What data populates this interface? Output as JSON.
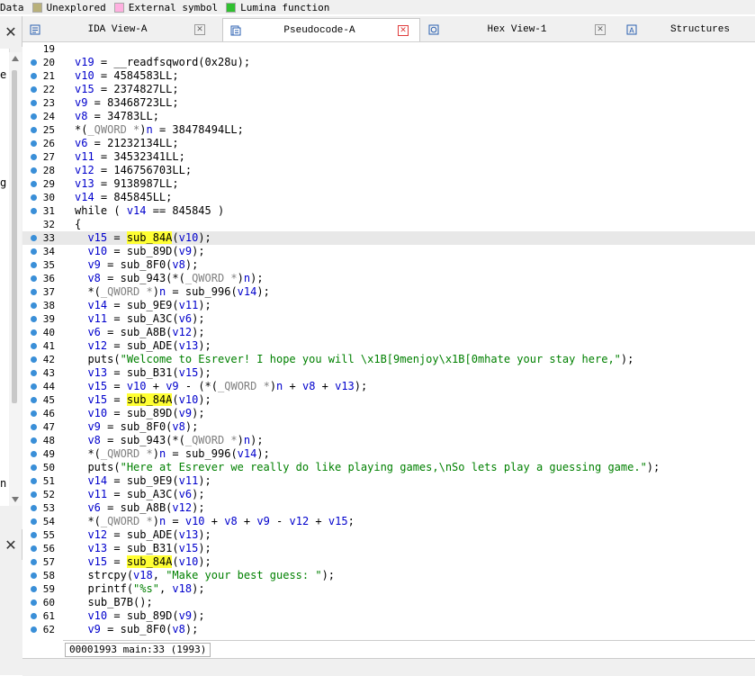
{
  "legend": [
    {
      "label": "Data",
      "color": null
    },
    {
      "label": "Unexplored",
      "color": "#b8b07a"
    },
    {
      "label": "External symbol",
      "color": "#ffb0e0"
    },
    {
      "label": "Lumina function",
      "color": "#30c030"
    }
  ],
  "left_pane": {
    "close_glyph": "✕",
    "cut_chars": [
      "e",
      "g",
      "n"
    ],
    "lower_close_glyph": "✕"
  },
  "tabs": [
    {
      "label": "IDA View-A",
      "icon": "ida-view-icon",
      "close": "✕",
      "active": false
    },
    {
      "label": "Pseudocode-A",
      "icon": "pseudocode-icon",
      "close": "✕",
      "active": true
    },
    {
      "label": "Hex View-1",
      "icon": "hex-view-icon",
      "close": "✕",
      "active": false
    },
    {
      "label": "Structures",
      "icon": "structures-icon",
      "close": "",
      "active": false
    }
  ],
  "code_lines": [
    {
      "n": "19",
      "text": ""
    },
    {
      "n": "20",
      "text": "v19 = __readfsqword(0x28u);"
    },
    {
      "n": "21",
      "text": "v10 = 4584583LL;"
    },
    {
      "n": "22",
      "text": "v15 = 2374827LL;"
    },
    {
      "n": "23",
      "text": "v9 = 83468723LL;"
    },
    {
      "n": "24",
      "text": "v8 = 34783LL;"
    },
    {
      "n": "25",
      "text": "*(_QWORD *)n = 38478494LL;"
    },
    {
      "n": "26",
      "text": "v6 = 21232134LL;"
    },
    {
      "n": "27",
      "text": "v11 = 34532341LL;"
    },
    {
      "n": "28",
      "text": "v12 = 146756703LL;"
    },
    {
      "n": "29",
      "text": "v13 = 9138987LL;"
    },
    {
      "n": "30",
      "text": "v14 = 845845LL;"
    },
    {
      "n": "31",
      "text": "while ( v14 == 845845 )"
    },
    {
      "n": "32",
      "text": "{"
    },
    {
      "n": "33",
      "text": "  v15 = sub_84A(v10);"
    },
    {
      "n": "34",
      "text": "  v10 = sub_89D(v9);"
    },
    {
      "n": "35",
      "text": "  v9 = sub_8F0(v8);"
    },
    {
      "n": "36",
      "text": "  v8 = sub_943(*(_QWORD *)n);"
    },
    {
      "n": "37",
      "text": "  *(_QWORD *)n = sub_996(v14);"
    },
    {
      "n": "38",
      "text": "  v14 = sub_9E9(v11);"
    },
    {
      "n": "39",
      "text": "  v11 = sub_A3C(v6);"
    },
    {
      "n": "40",
      "text": "  v6 = sub_A8B(v12);"
    },
    {
      "n": "41",
      "text": "  v12 = sub_ADE(v13);"
    },
    {
      "n": "42",
      "text": "  puts(\"Welcome to Esrever! I hope you will \\x1B[9menjoy\\x1B[0mhate your stay here,\");"
    },
    {
      "n": "43",
      "text": "  v13 = sub_B31(v15);"
    },
    {
      "n": "44",
      "text": "  v15 = v10 + v9 - (*(_QWORD *)n + v8 + v13);"
    },
    {
      "n": "45",
      "text": "  v15 = sub_84A(v10);"
    },
    {
      "n": "46",
      "text": "  v10 = sub_89D(v9);"
    },
    {
      "n": "47",
      "text": "  v9 = sub_8F0(v8);"
    },
    {
      "n": "48",
      "text": "  v8 = sub_943(*(_QWORD *)n);"
    },
    {
      "n": "49",
      "text": "  *(_QWORD *)n = sub_996(v14);"
    },
    {
      "n": "50",
      "text": "  puts(\"Here at Esrever we really do like playing games,\\nSo lets play a guessing game.\");"
    },
    {
      "n": "51",
      "text": "  v14 = sub_9E9(v11);"
    },
    {
      "n": "52",
      "text": "  v11 = sub_A3C(v6);"
    },
    {
      "n": "53",
      "text": "  v6 = sub_A8B(v12);"
    },
    {
      "n": "54",
      "text": "  *(_QWORD *)n = v10 + v8 + v9 - v12 + v15;"
    },
    {
      "n": "55",
      "text": "  v12 = sub_ADE(v13);"
    },
    {
      "n": "56",
      "text": "  v13 = sub_B31(v15);"
    },
    {
      "n": "57",
      "text": "  v15 = sub_84A(v10);"
    },
    {
      "n": "58",
      "text": "  strcpy(v18, \"Make your best guess: \");"
    },
    {
      "n": "59",
      "text": "  printf(\"%s\", v18);"
    },
    {
      "n": "60",
      "text": "  sub_B7B();"
    },
    {
      "n": "61",
      "text": "  v10 = sub_89D(v9);"
    },
    {
      "n": "62",
      "text": "  v9 = sub_8F0(v8);"
    }
  ],
  "current_line": "33",
  "highlight_token": "sub_84A",
  "status": "00001993 main:33 (1993)",
  "colors": {
    "keyword_black": "#000000",
    "var_blue": "#0000cc",
    "string_green": "#008000",
    "comment_gray": "#808080",
    "highlight_yellow": "#ffff33"
  }
}
